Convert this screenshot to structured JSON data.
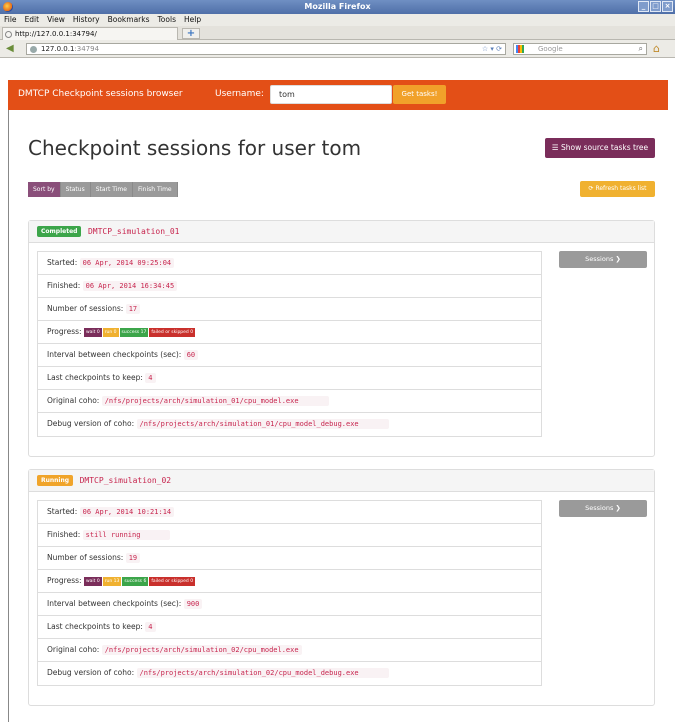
{
  "window": {
    "title": "Mozilla Firefox",
    "buttons": [
      "_",
      "□",
      "×"
    ]
  },
  "menubar": [
    "File",
    "Edit",
    "View",
    "History",
    "Bookmarks",
    "Tools",
    "Help"
  ],
  "tab": {
    "title": "http://127.0.0.1:34794/",
    "new_tab": "+"
  },
  "urlbar": {
    "host": "127.0.0.1",
    "port": ":34794",
    "search_placeholder": "Google"
  },
  "topnav": {
    "brand": "DMTCP Checkpoint sessions browser",
    "username_label": "Username:",
    "username_value": "tom",
    "get_tasks": "Get tasks!"
  },
  "page": {
    "title": "Checkpoint sessions for user tom",
    "show_source_tree": "Show source tasks tree",
    "refresh": "Refresh tasks list",
    "sort": [
      "Sort by",
      "Status",
      "Start Time",
      "Finish Time"
    ]
  },
  "labels": {
    "started": "Started:",
    "finished": "Finished:",
    "sessions": "Number of sessions:",
    "progress": "Progress:",
    "interval": "Interval between checkpoints (sec):",
    "keep": "Last checkpoints to keep:",
    "original": "Original coho:",
    "debug": "Debug version of coho:",
    "sessions_btn": "Sessions ❯"
  },
  "tasks": [
    {
      "status": "Completed",
      "status_color": "#3ca54a",
      "name": "DMTCP_simulation_01",
      "started": "06 Apr, 2014 09:25:04",
      "finished": "06 Apr, 2014 16:34:45",
      "sessions": "17",
      "progress": {
        "wait": "wait 0",
        "run": "run 0",
        "success": "success 17",
        "fail": "failed or skipped 0"
      },
      "interval": "60",
      "keep": "4",
      "original": "/nfs/projects/arch/simulation_01/cpu_model.exe",
      "debug": "/nfs/projects/arch/simulation_01/cpu_model_debug.exe"
    },
    {
      "status": "Running",
      "status_color": "#f0a42a",
      "name": "DMTCP_simulation_02",
      "started": "06 Apr, 2014 10:21:14",
      "finished": "still running",
      "sessions": "19",
      "progress": {
        "wait": "wait 0",
        "run": "run 13",
        "success": "success 6",
        "fail": "failed or skipped 0"
      },
      "interval": "900",
      "keep": "4",
      "original": "/nfs/projects/arch/simulation_02/cpu_model.exe",
      "debug": "/nfs/projects/arch/simulation_02/cpu_model_debug.exe"
    }
  ]
}
